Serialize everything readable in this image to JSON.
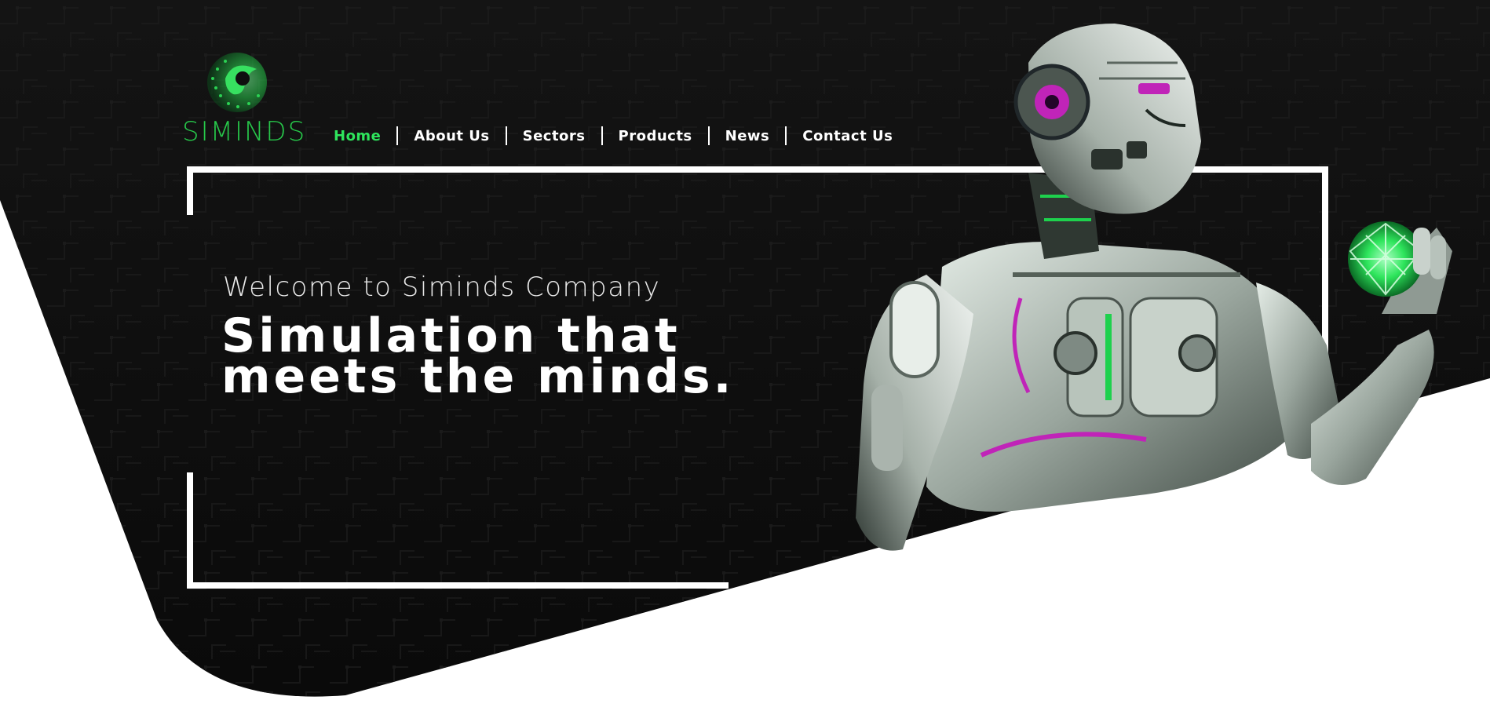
{
  "logo": {
    "wordmark": "SIMINDS",
    "icon": "green-dot-swirl-logo-icon"
  },
  "nav": {
    "items": [
      {
        "label": "Home",
        "active": true
      },
      {
        "label": "About Us",
        "active": false
      },
      {
        "label": "Sectors",
        "active": false
      },
      {
        "label": "Products",
        "active": false
      },
      {
        "label": "News",
        "active": false
      },
      {
        "label": "Contact Us",
        "active": false
      }
    ]
  },
  "hero": {
    "welcome": "Welcome to Siminds Company",
    "headline_line1": "Simulation that",
    "headline_line2": "meets the minds.",
    "image": "robot-holding-glowing-sphere"
  },
  "colors": {
    "background_dark": "#0d0d0d",
    "accent_green": "#2ee55c",
    "text_white": "#ffffff",
    "page_white": "#ffffff"
  }
}
